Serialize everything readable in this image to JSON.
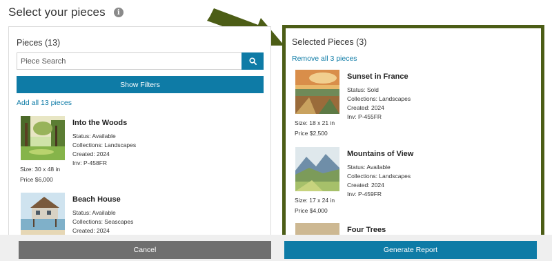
{
  "header": {
    "title": "Select your pieces",
    "info_icon": "info-icon"
  },
  "pieces_panel": {
    "heading": "Pieces (13)",
    "search_placeholder": "Piece Search",
    "search_icon": "search-icon",
    "filters_label": "Show Filters",
    "add_all_label": "Add all 13 pieces",
    "items": [
      {
        "name": "Into the Woods",
        "status": "Status: Available",
        "collections": "Collections: Landscapes",
        "created": "Created: 2024",
        "inv": "Inv: P-458FR",
        "size": "Size: 30 x 48 in",
        "price": "Price $6,000"
      },
      {
        "name": "Beach House",
        "status": "Status: Available",
        "collections": "Collections: Seascapes",
        "created": "Created: 2024"
      }
    ]
  },
  "selected_panel": {
    "heading": "Selected Pieces (3)",
    "remove_all_label": "Remove all 3 pieces",
    "items": [
      {
        "name": "Sunset in France",
        "status": "Status: Sold",
        "collections": "Collections: Landscapes",
        "created": "Created: 2024",
        "inv": "Inv: P-455FR",
        "size": "Size: 18 x 21 in",
        "price": "Price $2,500"
      },
      {
        "name": "Mountains of View",
        "status": "Status: Available",
        "collections": "Collections: Landscapes",
        "created": "Created: 2024",
        "inv": "Inv: P-459FR",
        "size": "Size: 17 x 24 in",
        "price": "Price $4,000"
      },
      {
        "name": "Four Trees"
      }
    ]
  },
  "footer": {
    "cancel_label": "Cancel",
    "report_label": "Generate Report"
  },
  "colors": {
    "accent": "#0e7ba6",
    "highlight_border": "#4c5d16",
    "cancel": "#6f6f6f"
  }
}
